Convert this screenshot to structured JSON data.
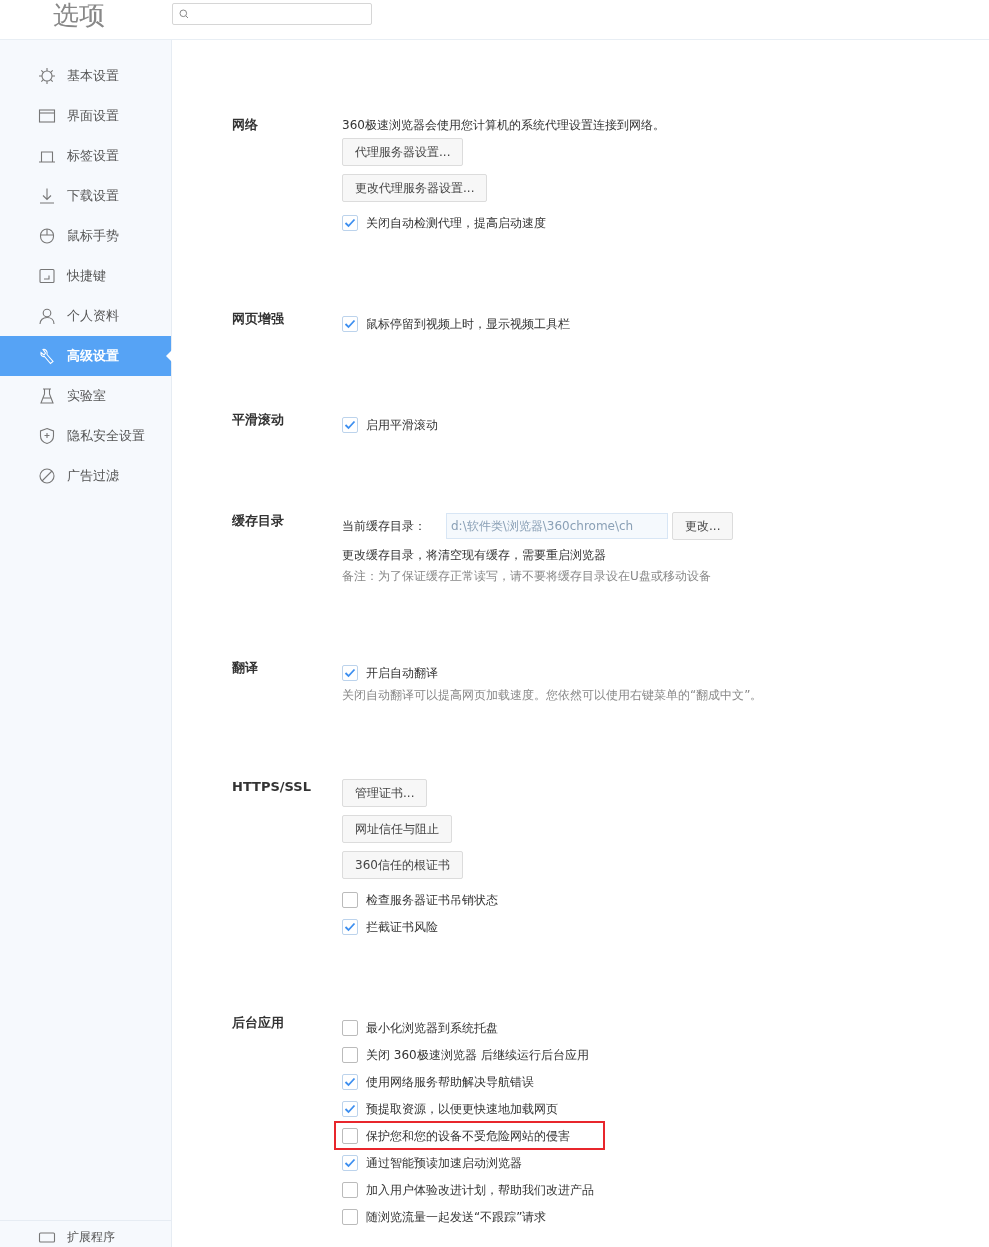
{
  "header": {
    "title": "选项"
  },
  "sidebar": {
    "items": [
      {
        "label": "基本设置",
        "selected": false
      },
      {
        "label": "界面设置",
        "selected": false
      },
      {
        "label": "标签设置",
        "selected": false
      },
      {
        "label": "下载设置",
        "selected": false
      },
      {
        "label": "鼠标手势",
        "selected": false
      },
      {
        "label": "快捷键",
        "selected": false
      },
      {
        "label": "个人资料",
        "selected": false
      },
      {
        "label": "高级设置",
        "selected": true
      },
      {
        "label": "实验室",
        "selected": false
      },
      {
        "label": "隐私安全设置",
        "selected": false
      },
      {
        "label": "广告过滤",
        "selected": false
      }
    ],
    "footer_item": {
      "label": "扩展程序"
    }
  },
  "sections": [
    {
      "title": "网络",
      "items": [
        {
          "kind": "text",
          "text": "360极速浏览器会使用您计算机的系统代理设置连接到网络。"
        },
        {
          "kind": "button",
          "text": "代理服务器设置..."
        },
        {
          "kind": "button",
          "text": "更改代理服务器设置..."
        },
        {
          "kind": "checkbox",
          "text": "关闭自动检测代理，提高启动速度",
          "checked": true
        }
      ]
    },
    {
      "title": "网页增强",
      "items": [
        {
          "kind": "checkbox",
          "text": "鼠标停留到视频上时，显示视频工具栏",
          "checked": true
        }
      ]
    },
    {
      "title": "平滑滚动",
      "items": [
        {
          "kind": "checkbox",
          "text": "启用平滑滚动",
          "checked": true
        }
      ]
    },
    {
      "title": "缓存目录",
      "items": [
        {
          "kind": "path",
          "label": "当前缓存目录：",
          "value": "d:\\软件类\\浏览器\\360chrome\\ch",
          "button": "更改..."
        },
        {
          "kind": "text",
          "text": "更改缓存目录，将清空现有缓存，需要重启浏览器"
        },
        {
          "kind": "note",
          "text": "备注：为了保证缓存正常读写，请不要将缓存目录设在U盘或移动设备"
        }
      ]
    },
    {
      "title": "翻译",
      "items": [
        {
          "kind": "checkbox",
          "text": "开启自动翻译",
          "checked": true
        },
        {
          "kind": "note",
          "text": "关闭自动翻译可以提高网页加载速度。您依然可以使用右键菜单的“翻成中文”。"
        }
      ]
    },
    {
      "title": "HTTPS/SSL",
      "items": [
        {
          "kind": "button",
          "text": "管理证书..."
        },
        {
          "kind": "button",
          "text": "网址信任与阻止"
        },
        {
          "kind": "button",
          "text": "360信任的根证书"
        },
        {
          "kind": "checkbox",
          "text": "检查服务器证书吊销状态",
          "checked": false
        },
        {
          "kind": "checkbox",
          "text": "拦截证书风险",
          "checked": true
        }
      ]
    },
    {
      "title": "后台应用",
      "items": [
        {
          "kind": "checkbox",
          "text": "最小化浏览器到系统托盘",
          "checked": false
        },
        {
          "kind": "checkbox",
          "text": "关闭 360极速浏览器 后继续运行后台应用",
          "checked": false
        },
        {
          "kind": "checkbox",
          "text": "使用网络服务帮助解决导航错误",
          "checked": true
        },
        {
          "kind": "checkbox",
          "text": "预提取资源，以便更快速地加载网页",
          "checked": true
        },
        {
          "kind": "checkbox",
          "text": "保护您和您的设备不受危险网站的侵害",
          "checked": false,
          "highlighted": true
        },
        {
          "kind": "checkbox",
          "text": "通过智能预读加速启动浏览器",
          "checked": true
        },
        {
          "kind": "checkbox",
          "text": "加入用户体验改进计划，帮助我们改进产品",
          "checked": false
        },
        {
          "kind": "checkbox",
          "text": "随浏览流量一起发送“不跟踪”请求",
          "checked": false
        }
      ]
    }
  ]
}
